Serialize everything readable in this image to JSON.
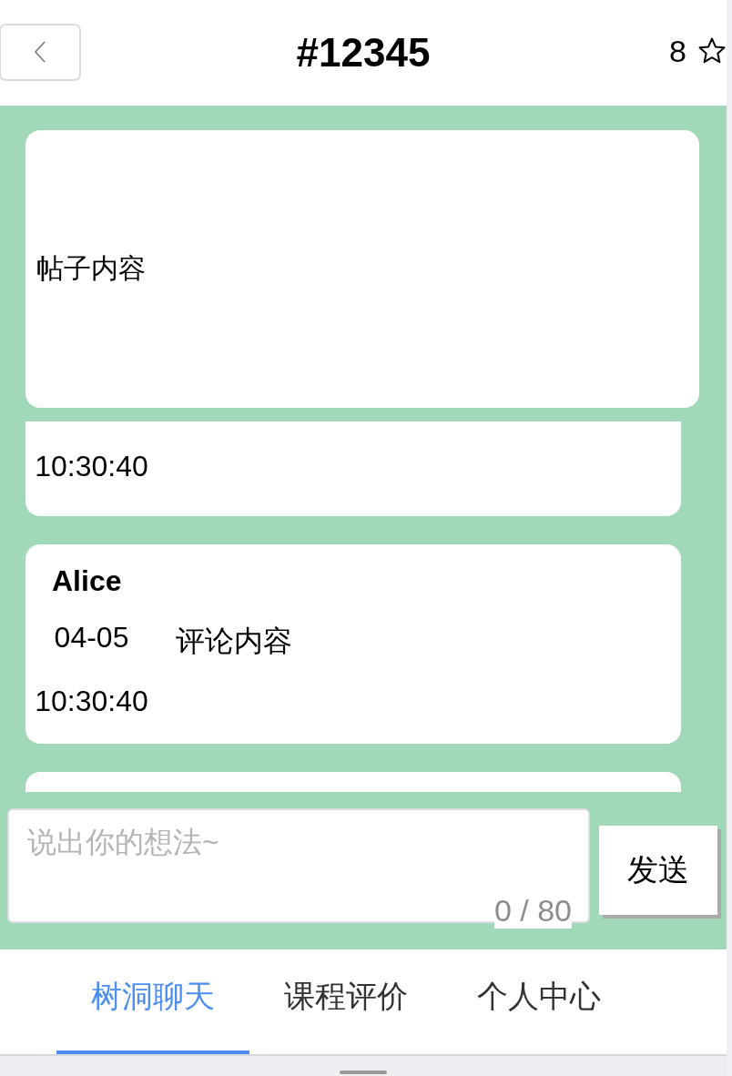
{
  "header": {
    "title": "#12345",
    "star_count": "8"
  },
  "post": {
    "content": "帖子内容"
  },
  "comments": [
    {
      "kind": "partial",
      "date_time": "10:30:40"
    },
    {
      "kind": "full",
      "author": "Alice",
      "date_time": "04-05 10:30:40",
      "content": "评论内容"
    },
    {
      "kind": "clipped"
    }
  ],
  "composer": {
    "placeholder": "说出你的想法~",
    "counter": "0 / 80",
    "send_label": "发送"
  },
  "tabs": [
    {
      "label": "树洞聊天",
      "selected": true
    },
    {
      "label": "课程评价",
      "selected": false
    },
    {
      "label": "个人中心",
      "selected": false
    }
  ]
}
